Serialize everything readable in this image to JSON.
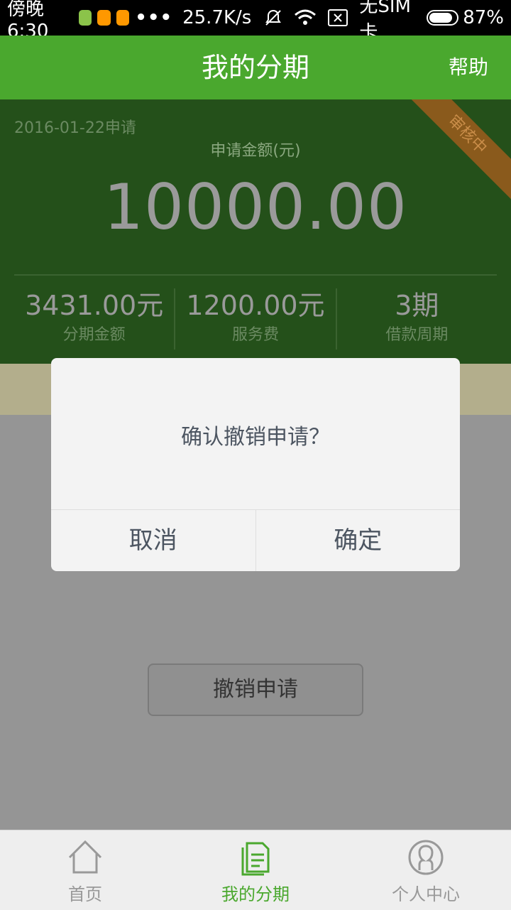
{
  "status_bar": {
    "time": "傍晚6:30",
    "network_speed": "25.7K/s",
    "sim_status": "无SIM卡",
    "battery": "87%",
    "battery_level": 0.87
  },
  "header": {
    "title": "我的分期",
    "help_label": "帮助"
  },
  "summary": {
    "apply_date": "2016-01-22申请",
    "amount_label": "申请金额(元)",
    "amount": "10000.00",
    "status_ribbon": "审核中",
    "stats": [
      {
        "value": "3431.00元",
        "label": "分期金额"
      },
      {
        "value": "1200.00元",
        "label": "服务费"
      },
      {
        "value": "3期",
        "label": "借款周期"
      }
    ]
  },
  "cancel_application_label": "撤销申请",
  "dialog": {
    "message": "确认撤销申请？",
    "cancel_label": "取消",
    "confirm_label": "确定"
  },
  "bottom_nav": {
    "items": [
      {
        "label": "首页",
        "icon": "home-icon",
        "active": false
      },
      {
        "label": "我的分期",
        "icon": "document-icon",
        "active": true
      },
      {
        "label": "个人中心",
        "icon": "user-icon",
        "active": false
      }
    ]
  },
  "colors": {
    "brand_green": "#4aa82e",
    "card_green": "#24501a",
    "ribbon": "#8a5a1c",
    "overlay": "#959595"
  }
}
